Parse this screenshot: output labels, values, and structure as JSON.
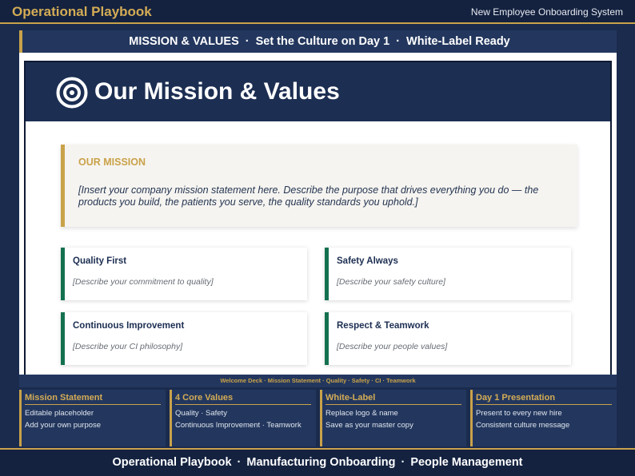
{
  "header": {
    "brand": "Operational Playbook",
    "system": "New Employee Onboarding System"
  },
  "banner": {
    "parts": [
      "MISSION & VALUES",
      "Set the Culture on Day 1",
      "White-Label Ready"
    ],
    "separator": "·"
  },
  "slide": {
    "title": "Our Mission & Values",
    "icon": "target-icon",
    "mission": {
      "label": "OUR MISSION",
      "text": "[Insert your company mission statement here. Describe the purpose that drives everything you do — the products you build, the patients you serve, the quality standards you uphold.]"
    },
    "values": [
      {
        "title": "Quality First",
        "desc": "[Describe your commitment to quality]"
      },
      {
        "title": "Safety Always",
        "desc": "[Describe your safety culture]"
      },
      {
        "title": "Continuous Improvement",
        "desc": "[Describe your CI philosophy]"
      },
      {
        "title": "Respect & Teamwork",
        "desc": "[Describe your people values]"
      }
    ]
  },
  "caption": "Welcome Deck · Mission Statement · Quality · Safety · CI · Teamwork",
  "info_boxes": [
    {
      "title": "Mission Statement",
      "lines": [
        "Editable placeholder",
        "Add your own purpose"
      ]
    },
    {
      "title": "4 Core Values",
      "lines": [
        "Quality · Safety",
        "Continuous Improvement · Teamwork"
      ]
    },
    {
      "title": "White-Label",
      "lines": [
        "Replace logo & name",
        "Save as your master copy"
      ]
    },
    {
      "title": "Day 1 Presentation",
      "lines": [
        "Present to every new hire",
        "Consistent culture message"
      ]
    }
  ],
  "footer": {
    "parts": [
      "Operational Playbook",
      "Manufacturing Onboarding",
      "People Management"
    ],
    "separator": "·"
  },
  "colors": {
    "navy": "#1a2b4e",
    "gold": "#c9a24a",
    "green": "#14714f",
    "white": "#ffffff"
  }
}
